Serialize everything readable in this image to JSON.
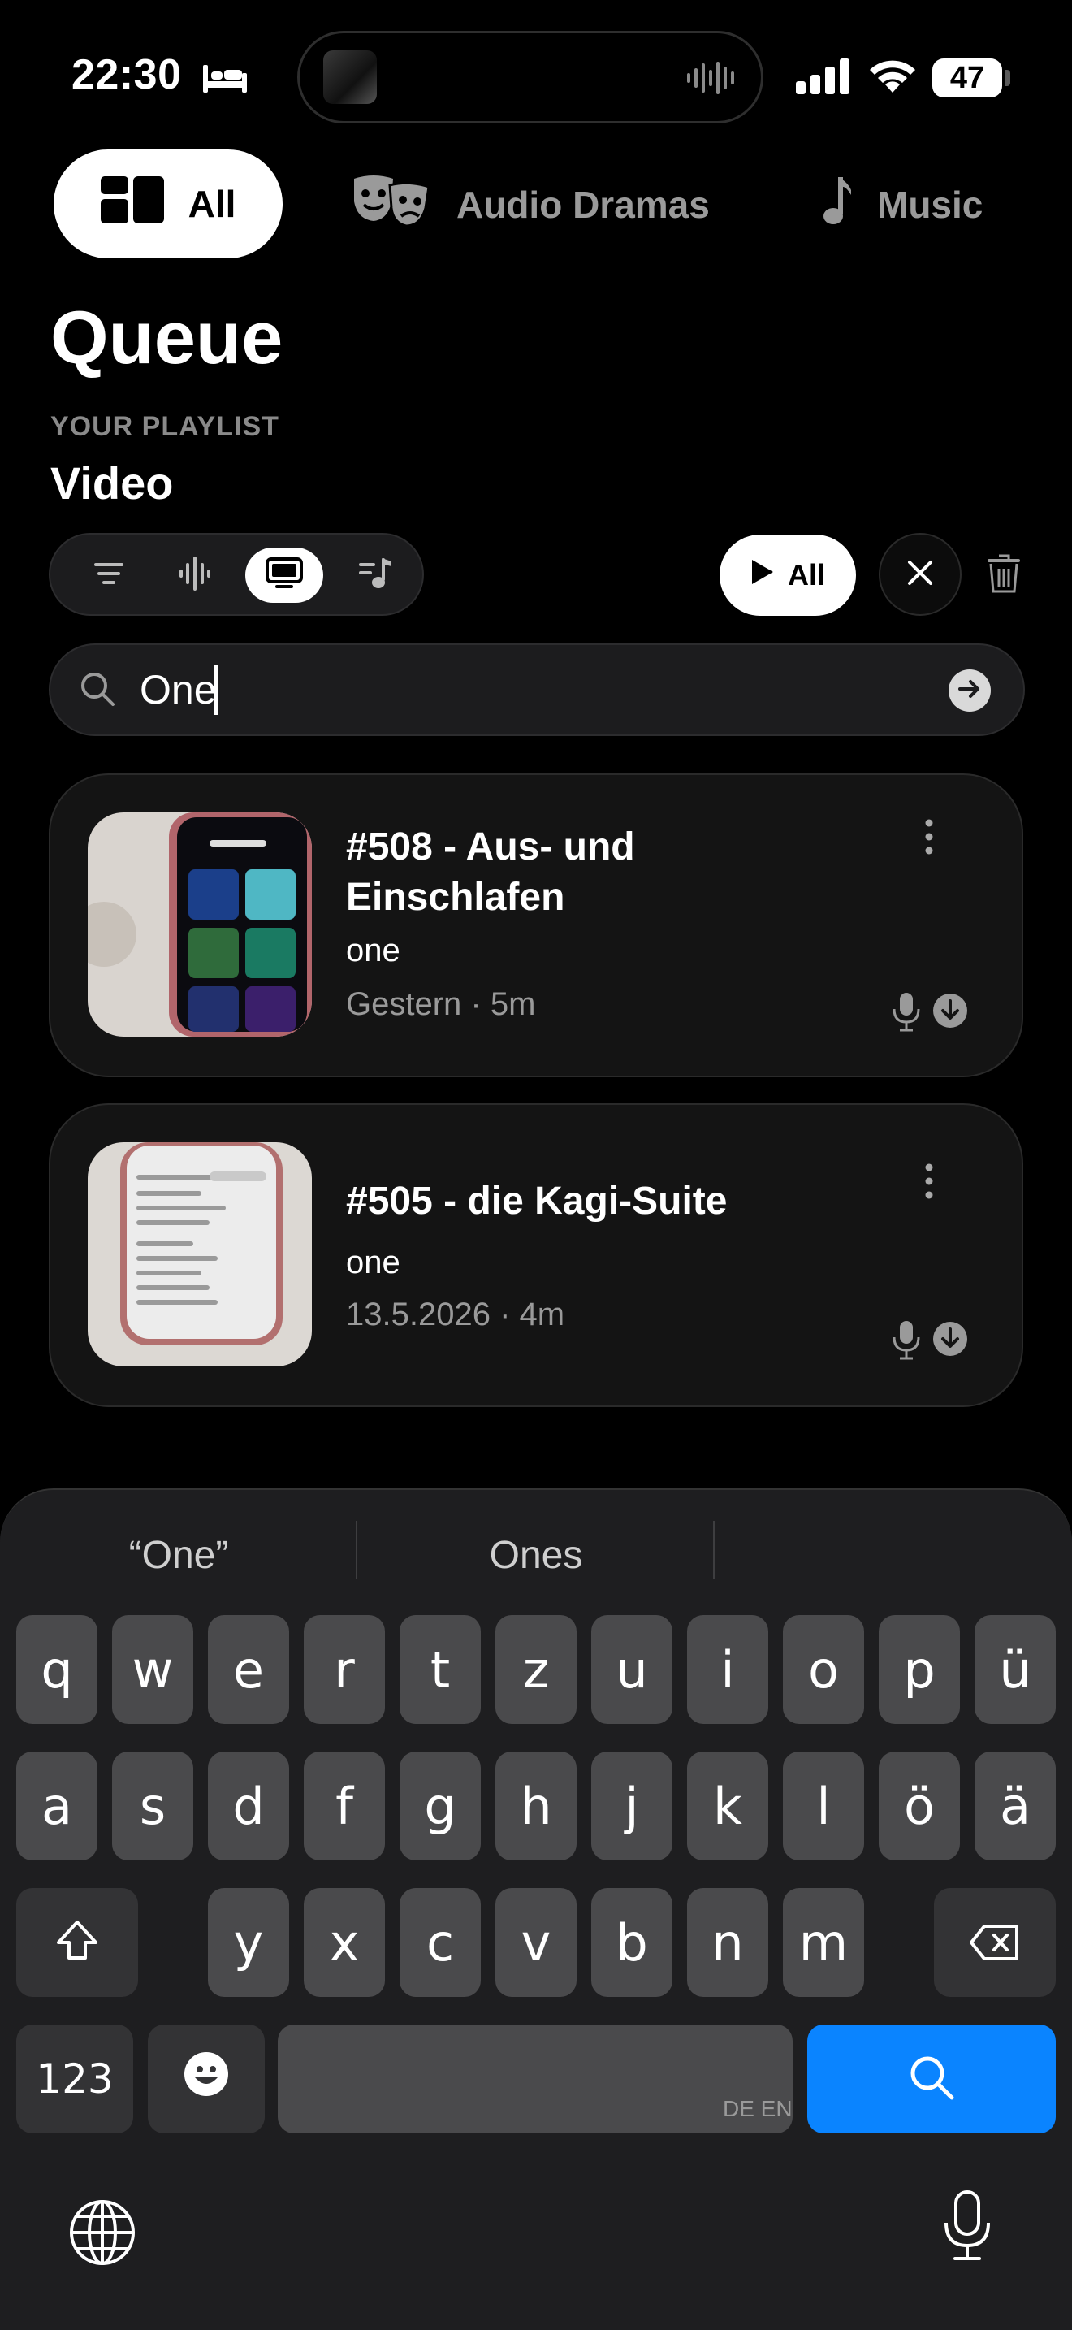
{
  "status_bar": {
    "time": "22:30",
    "battery": "47"
  },
  "tabs": [
    {
      "label": "All",
      "icon": "grid-icon",
      "selected": true
    },
    {
      "label": "Audio Dramas",
      "icon": "theater-masks-icon"
    },
    {
      "label": "Music",
      "icon": "music-note-icon"
    }
  ],
  "header": {
    "title": "Queue",
    "playlist_label": "YOUR PLAYLIST",
    "playlist_name": "Video"
  },
  "filters": {
    "items": [
      "list-icon",
      "waveform-icon",
      "tv-icon",
      "music-list-icon"
    ],
    "selected": "tv-icon"
  },
  "actions": {
    "play_all_label": "All"
  },
  "search": {
    "value": "One"
  },
  "results": [
    {
      "title": "#508 - Aus- und Einschlafen",
      "subtitle": "one",
      "meta": "Gestern · 5m"
    },
    {
      "title": "#505 - die Kagi-Suite",
      "subtitle": "one",
      "meta": "13.5.2026 · 4m"
    }
  ],
  "keyboard": {
    "suggestions": [
      "“One”",
      "Ones",
      ""
    ],
    "row1": [
      "q",
      "w",
      "e",
      "r",
      "t",
      "z",
      "u",
      "i",
      "o",
      "p",
      "ü"
    ],
    "row2": [
      "a",
      "s",
      "d",
      "f",
      "g",
      "h",
      "j",
      "k",
      "l",
      "ö",
      "ä"
    ],
    "row3": [
      "y",
      "x",
      "c",
      "v",
      "b",
      "n",
      "m"
    ],
    "numbers_label": "123",
    "space_language": "DE EN",
    "accent_color": "#0a84ff"
  }
}
